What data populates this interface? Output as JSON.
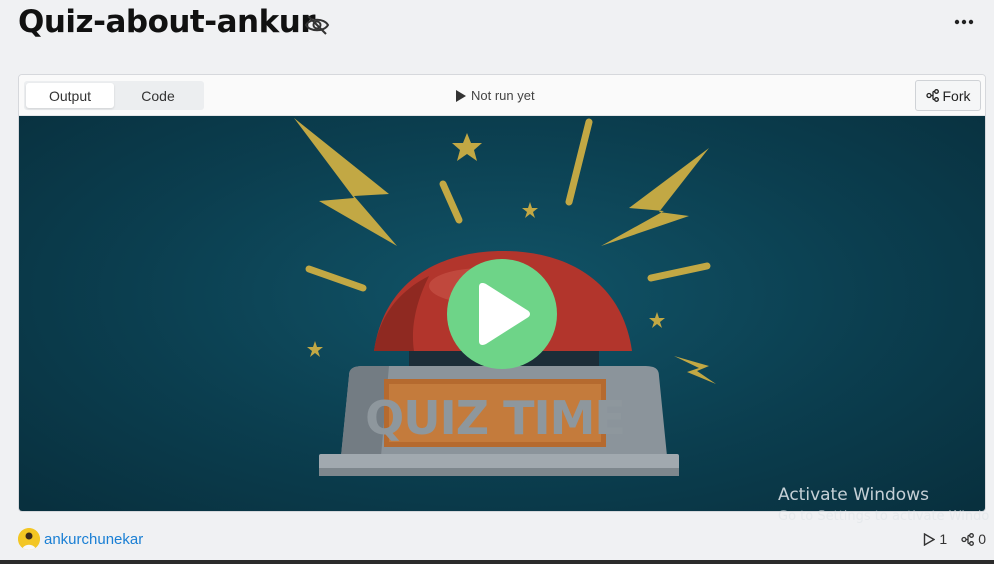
{
  "page": {
    "title": "Quiz-about-ankur"
  },
  "icons": {
    "visibility": "eye-off-icon",
    "more": "more-horizontal-icon",
    "play_status": "play-icon",
    "fork": "fork-icon",
    "runs": "play-outline-icon",
    "forks": "fork-icon"
  },
  "toolbar": {
    "tabs": [
      {
        "label": "Output",
        "active": true
      },
      {
        "label": "Code",
        "active": false
      }
    ],
    "run_status": "Not run yet",
    "fork_label": "Fork"
  },
  "preview": {
    "banner_text": "QUIZ TIME"
  },
  "footer": {
    "author": "ankurchunekar",
    "runs_count": "1",
    "forks_count": "0"
  },
  "watermark": {
    "title": "Activate Windows",
    "subtitle": "Go to Settings to activate Windo"
  },
  "colors": {
    "play_button": "#6ed488",
    "background_teal": "#0b3e4f",
    "link_blue": "#1a7fd4",
    "accent_gold": "#c9ad45"
  }
}
